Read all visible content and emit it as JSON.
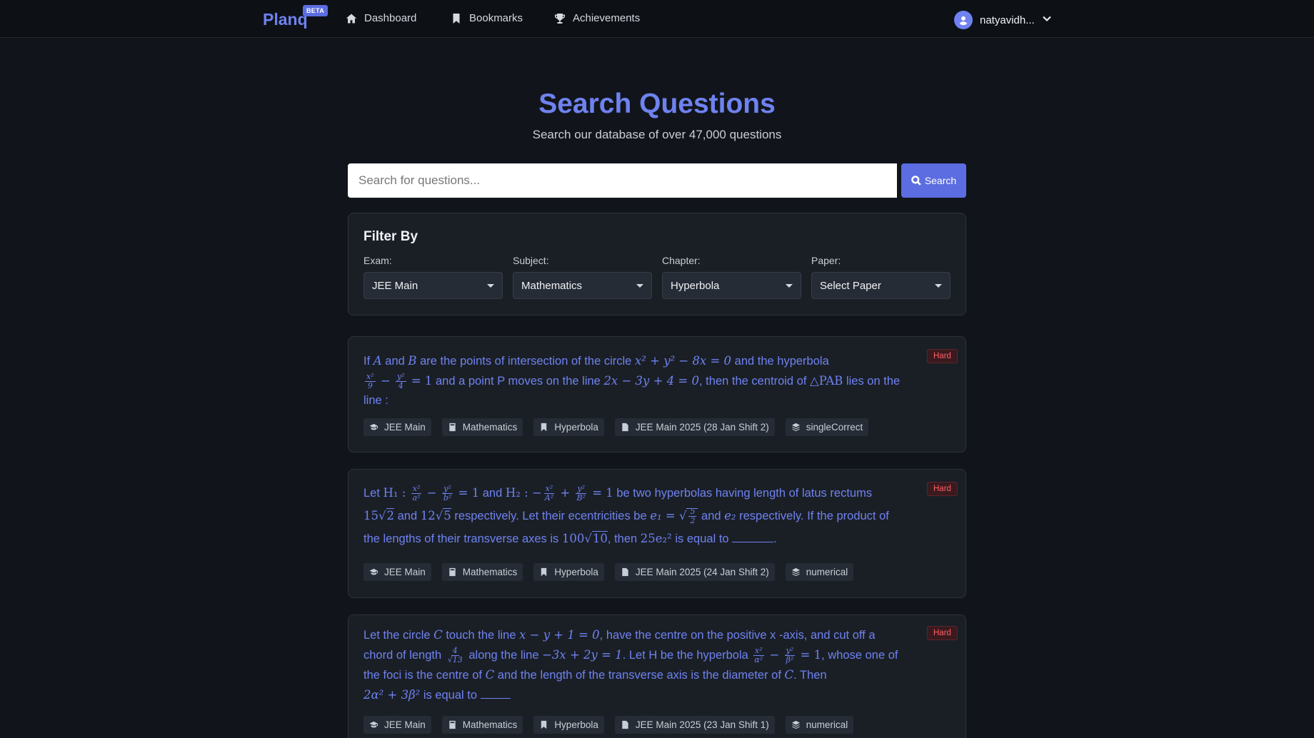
{
  "nav": {
    "brand": "Planq",
    "beta": "BETA",
    "links": [
      "Dashboard",
      "Bookmarks",
      "Achievements"
    ],
    "user": "natyavidh..."
  },
  "hero": {
    "title": "Search Questions",
    "subtitle": "Search our database of over 47,000 questions",
    "search_placeholder": "Search for questions...",
    "search_button": "Search"
  },
  "filter": {
    "title": "Filter By",
    "exam": {
      "label": "Exam:",
      "value": "JEE Main"
    },
    "subject": {
      "label": "Subject:",
      "value": "Mathematics"
    },
    "chapter": {
      "label": "Chapter:",
      "value": "Hyperbola"
    },
    "paper": {
      "label": "Paper:",
      "value": "Select Paper"
    }
  },
  "questions": [
    {
      "difficulty": "Hard",
      "text": {
        "p1": "If ",
        "A": "A",
        "and": " and ",
        "B": "B",
        "p2": " are the points of intersection of the circle ",
        "eq1": "x² + y² − 8x = 0",
        "p3": " and the hyperbola",
        "f1n": "x²",
        "f1d": "9",
        "minus": " − ",
        "f2n": "y²",
        "f2d": "4",
        "eq2": " = 1",
        "p4": " and a point P moves on the line ",
        "eq3": "2x − 3y + 4 = 0",
        "p5": ", then the centroid of ",
        "tri": "△PAB",
        "p6": " lies on the line :"
      },
      "tags": [
        "JEE Main",
        "Mathematics",
        "Hyperbola",
        "JEE Main 2025 (28 Jan Shift 2)",
        "singleCorrect"
      ]
    },
    {
      "difficulty": "Hard",
      "text": {
        "p1": "Let ",
        "H1": "H₁ : ",
        "f1n": "x²",
        "f1d": "a²",
        "minus": " − ",
        "f2n": "y²",
        "f2d": "b²",
        "eq1": " = 1",
        "and": " and ",
        "H2": "H₂ : −",
        "f3n": "x²",
        "f3d": "A²",
        "plus": " + ",
        "f4n": "y²",
        "f4d": "B²",
        "eq2": " = 1",
        "p2": " be two hyperbolas having length of latus rectums",
        "v1": "15",
        "r1": "2",
        "and2": " and ",
        "v2": "12",
        "r2": "5",
        "p3": " respectively. Let their ecentricities be ",
        "e1": "e₁ = ",
        "f5n": "5",
        "f5d": "2",
        "and3": " and ",
        "e2": "e₂",
        "p4": " respectively. If the product of the lengths of their transverse axes is ",
        "v3": "100",
        "r3": "10",
        "p5": ", then ",
        "v4": "25e₂²",
        "p6": " is equal to ",
        "p7": "."
      },
      "tags": [
        "JEE Main",
        "Mathematics",
        "Hyperbola",
        "JEE Main 2025 (24 Jan Shift 2)",
        "numerical"
      ]
    },
    {
      "difficulty": "Hard",
      "text": {
        "p1": "Let the circle ",
        "C": "C",
        "p2": " touch the line ",
        "eq1": "x − y + 1 = 0",
        "p3": ", have the centre on the positive x -axis, and cut off a chord of length ",
        "f1n": "4",
        "f1d": "√13",
        "p4": " along the line ",
        "eq2": "−3x + 2y = 1",
        "p5": ". Let H be the hyperbola ",
        "f2n": "x²",
        "f2d": "α²",
        "minus": " − ",
        "f3n": "y²",
        "f3d": "β²",
        "eq3": " = 1",
        "p6": ", whose one of the foci is the centre of ",
        "C2": "C",
        "p7": " and the length of the transverse axis is the diameter of ",
        "C3": "C",
        "p8": ". Then ",
        "eq4": "2α² + 3β²",
        "p9": " is equal to "
      },
      "tags": [
        "JEE Main",
        "Mathematics",
        "Hyperbola",
        "JEE Main 2025 (23 Jan Shift 1)",
        "numerical"
      ]
    }
  ],
  "colors": {
    "accent": "#6f82f0",
    "background": "#11151b",
    "card": "#1a1f26",
    "hard": "#ff5e68"
  }
}
